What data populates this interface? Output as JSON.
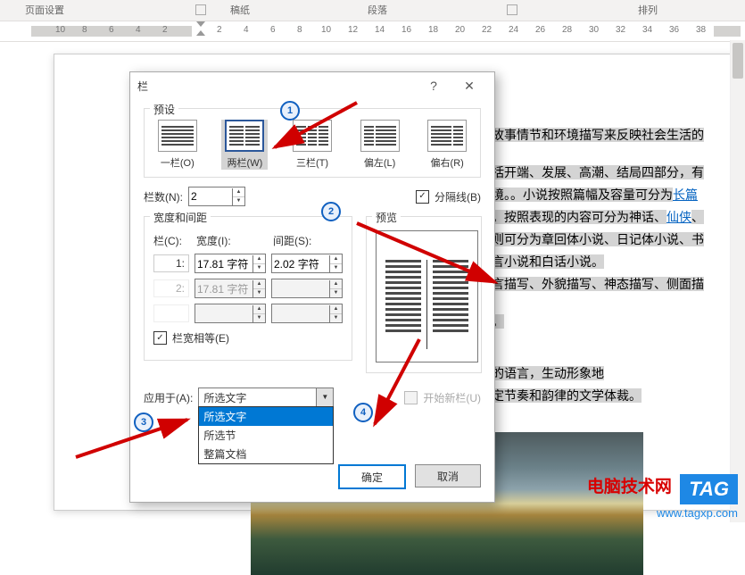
{
  "ribbon": {
    "group_page_setup": "页面设置",
    "group_paper": "稿纸",
    "group_paragraph": "段落",
    "group_arrange": "排列"
  },
  "ruler": [
    "10",
    "8",
    "6",
    "4",
    "2",
    "",
    "2",
    "4",
    "6",
    "8",
    "10",
    "12",
    "14",
    "16",
    "18",
    "20",
    "22",
    "24",
    "26",
    "28",
    "30",
    "32",
    "34",
    "36",
    "38"
  ],
  "doc": {
    "line1": "故事情节和环境描写来反映社会生活的",
    "line2a": "括开端、发展、高潮、结局四部分，有",
    "line2b": "境。。小说按照篇幅及容量可分为",
    "line2b_link": "长篇",
    "line3a": "。按照表现的内容可分为神话、",
    "line3a_link": "仙侠",
    "line3b": "、",
    "line4": "则可分为章回体小说、日记体小说、书",
    "line5": "言小说和白话小说。",
    "line6": "言描写、外貌描写、神态描写、侧面描",
    "line7": "。",
    "line8": "的语言，生动形象地",
    "line9": "定节奏和韵律的文学体裁。"
  },
  "dialog": {
    "title": "栏",
    "section_preset": "预设",
    "preset_one": "一栏(O)",
    "preset_two": "两栏(W)",
    "preset_three": "三栏(T)",
    "preset_left": "偏左(L)",
    "preset_right": "偏右(R)",
    "cols_label": "栏数(N):",
    "cols_value": "2",
    "divider_label": "分隔线(B)",
    "section_width": "宽度和间距",
    "col_header": "栏(C):",
    "width_header": "宽度(I):",
    "spacing_header": "间距(S):",
    "row1_col": "1:",
    "row1_width": "17.81 字符",
    "row1_spacing": "2.02 字符",
    "row2_col": "2:",
    "row2_width": "17.81 字符",
    "equal_label": "栏宽相等(E)",
    "section_preview": "预览",
    "apply_label": "应用于(A):",
    "apply_value": "所选文字",
    "opt1": "所选文字",
    "opt2": "所选节",
    "opt3": "整篇文档",
    "newcol_label": "开始新栏(U)",
    "ok": "确定",
    "cancel": "取消",
    "help": "?",
    "close": "✕"
  },
  "watermark": {
    "l1": "电脑技术网",
    "tag": "TAG",
    "l2": "www.tagxp.com"
  }
}
